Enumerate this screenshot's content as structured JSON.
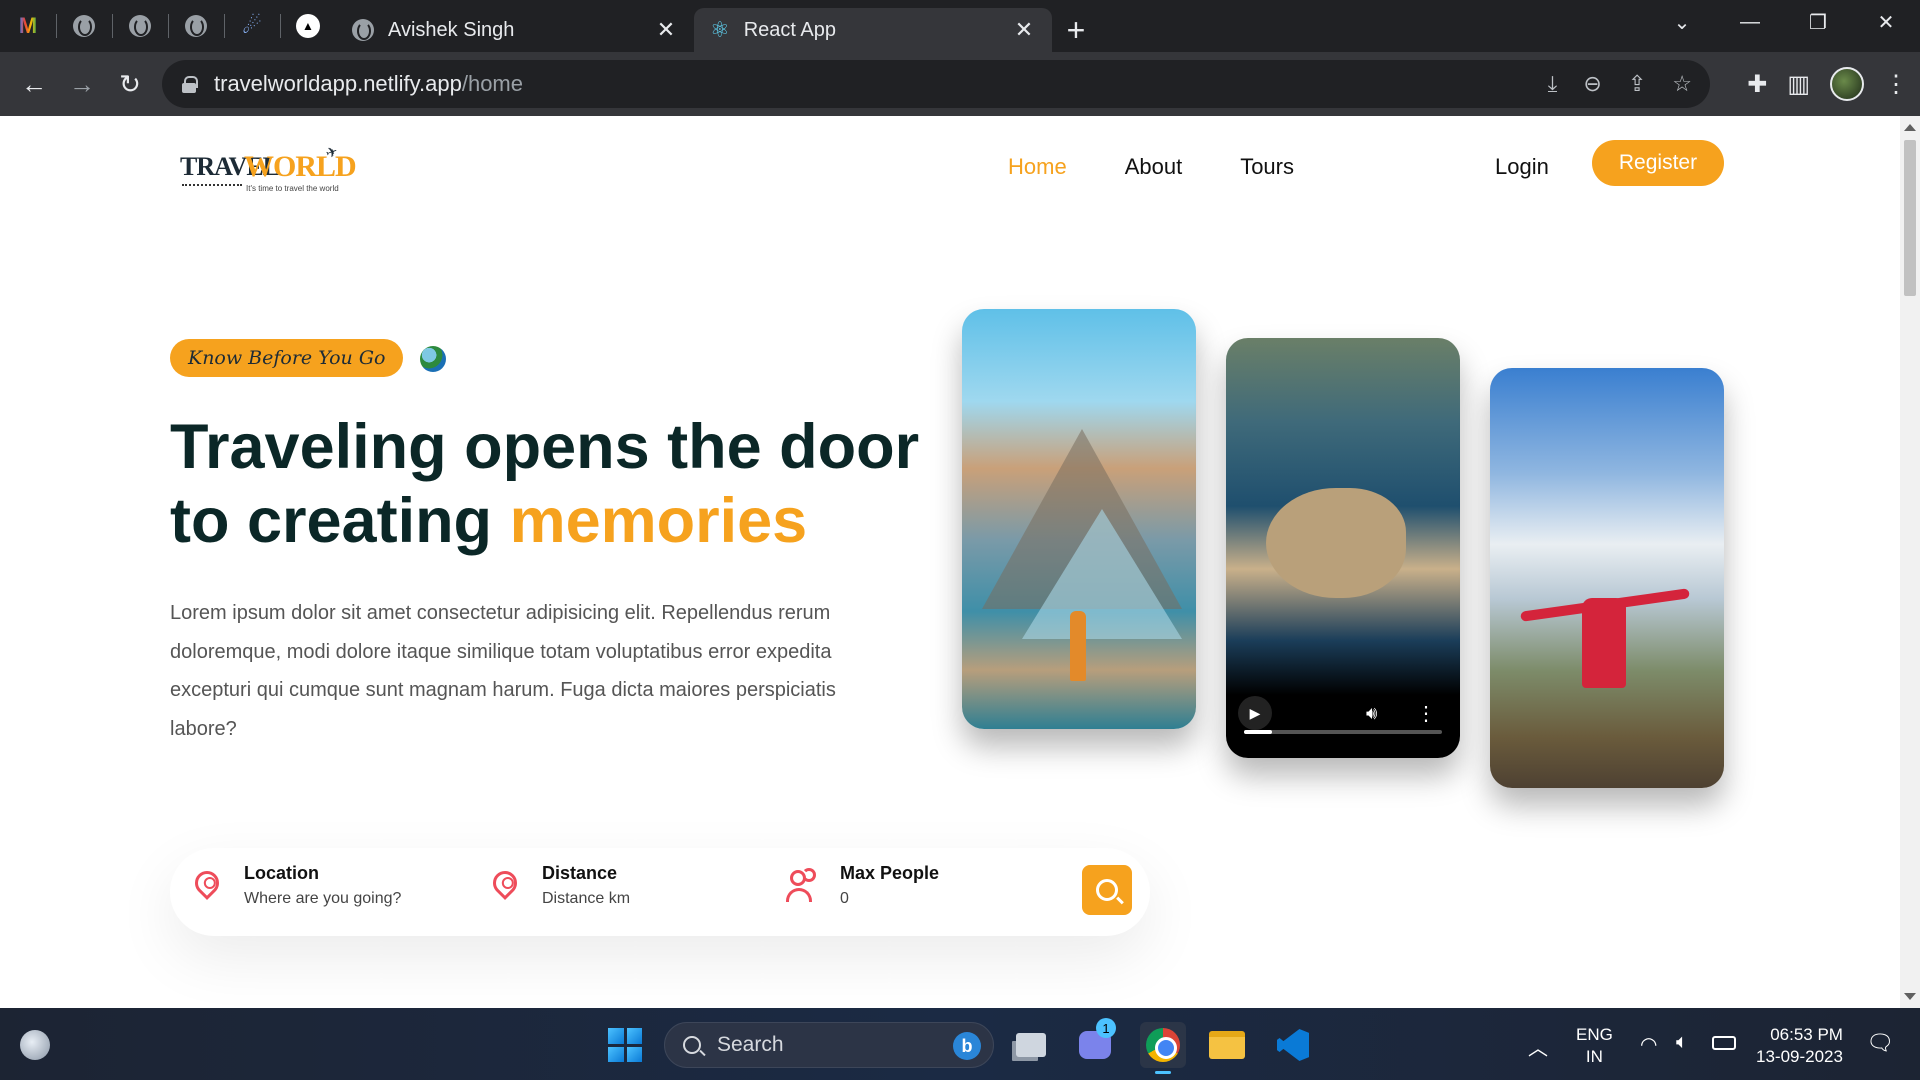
{
  "browser": {
    "tabs": [
      {
        "title": "Avishek Singh",
        "active": false
      },
      {
        "title": "React App",
        "active": true
      }
    ],
    "address": {
      "host": "travelworldapp.netlify.app",
      "path": "/home"
    }
  },
  "site": {
    "logo": {
      "part1": "TRAVEL",
      "part2": "WORLD",
      "tagline": "It's time to travel the world"
    },
    "nav": [
      "Home",
      "About",
      "Tours"
    ],
    "active_nav": "Home",
    "login": "Login",
    "register": "Register"
  },
  "hero": {
    "badge": "Know Before You Go",
    "title_line1": "Traveling opens the door",
    "title_line2_prefix": "to creating ",
    "title_accent": "memories",
    "text": "Lorem ipsum dolor sit amet consectetur adipisicing elit. Repellendus rerum doloremque, modi dolore itaque similique totam voluptatibus error expedita excepturi qui cumque sunt magnam harum. Fuga dicta maiores perspiciatis labore?",
    "video_progress": 0.14
  },
  "search": {
    "fields": [
      {
        "label": "Location",
        "value": "Where are you going?",
        "icon": "map-pin-icon"
      },
      {
        "label": "Distance",
        "value": "Distance km",
        "icon": "map-pin-alt-icon"
      },
      {
        "label": "Max People",
        "value": "0",
        "icon": "people-icon"
      }
    ]
  },
  "taskbar": {
    "search_placeholder": "Search",
    "chat_badge": "1",
    "lang_line1": "ENG",
    "lang_line2": "IN",
    "time": "06:53 PM",
    "date": "13-09-2023"
  },
  "colors": {
    "accent": "#f6a21e",
    "heading": "#0b2727",
    "icon_red": "#ee4c5a"
  }
}
